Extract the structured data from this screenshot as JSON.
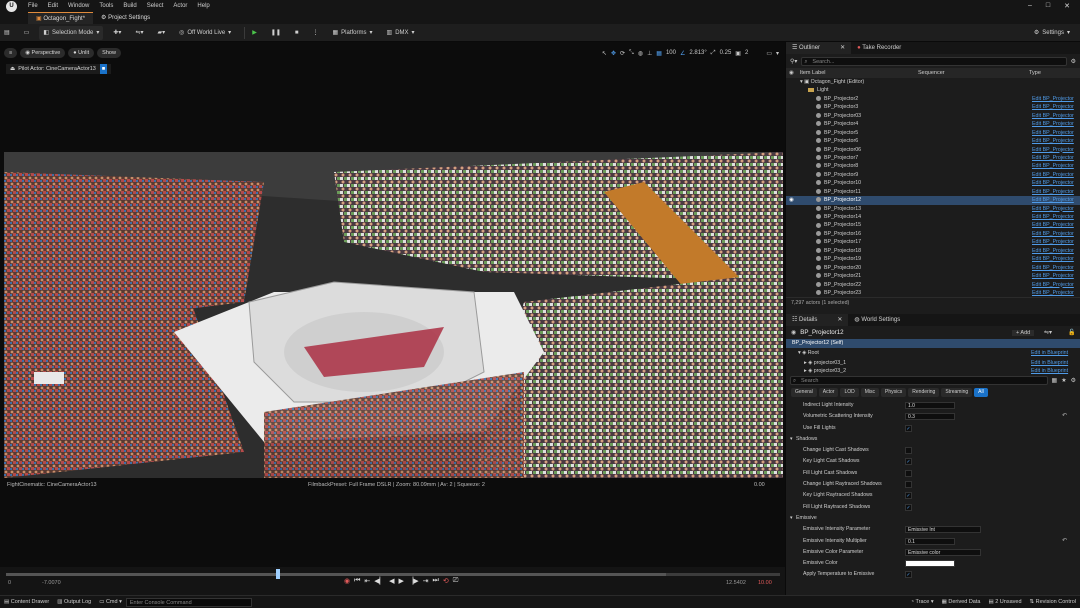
{
  "menu": {
    "logo": "U",
    "items": [
      "File",
      "Edit",
      "Window",
      "Tools",
      "Build",
      "Select",
      "Actor",
      "Help"
    ]
  },
  "window_controls": {
    "minimize": "–",
    "maximize": "□",
    "close": "✕"
  },
  "tabs": {
    "level": "Octagon_Fight*",
    "project_settings": "Project Settings"
  },
  "toolbar": {
    "selection_mode": "Selection Mode",
    "off_world": "Off World Live",
    "platforms": "Platforms",
    "dmx": "DMX",
    "settings": "Settings"
  },
  "viewport": {
    "perspective": "Perspective",
    "unlit": "Unlit",
    "show": "Show",
    "pilot": "Pilot Actor: CineCameraActor13",
    "snap": {
      "grid": "100",
      "angle": "2.813°",
      "scale": "0.25",
      "cams": "2"
    },
    "camera_label": "FightCinematic: CineCameraActor13",
    "filmback": "FilmbackPreset: Full Frame DSLR | Zoom: 80.09mm | Av: 2 | Squeeze: 2",
    "zero": "0.00",
    "scene_colors": {
      "floor": "#3a3a3a",
      "crowd": "#7d4b3a",
      "ring": "#e9e9e9",
      "stand": "#c27a2a"
    }
  },
  "timeline": {
    "start": "0",
    "left": "-7.0070",
    "end_left": "12.5402",
    "end": "10.00"
  },
  "statusbar": {
    "content_drawer": "Content Drawer",
    "output_log": "Output Log",
    "cmd": "Cmd",
    "console_placeholder": "Enter Console Command",
    "trace": "Trace",
    "derived_data": "Derived Data",
    "unsaved": "2 Unsaved",
    "revision": "Revision Control"
  },
  "outliner": {
    "tab": "Outliner",
    "tab2": "Take Recorder",
    "search_placeholder": "Search...",
    "col_label": "Item Label",
    "col_sequencer": "Sequencer",
    "col_type": "Type",
    "root": "Octagon_Fight (Editor)",
    "folder": "Light",
    "items": [
      "BP_Projector2",
      "BP_Projector3",
      "BP_Projector03",
      "BP_Projector4",
      "BP_Projector5",
      "BP_Projector6",
      "BP_Projector06",
      "BP_Projector7",
      "BP_Projector8",
      "BP_Projector9",
      "BP_Projector10",
      "BP_Projector11",
      "BP_Projector12",
      "BP_Projector13",
      "BP_Projector14",
      "BP_Projector15",
      "BP_Projector16",
      "BP_Projector17",
      "BP_Projector18",
      "BP_Projector19",
      "BP_Projector20",
      "BP_Projector21",
      "BP_Projector22",
      "BP_Projector23"
    ],
    "selected_index": 12,
    "type_link": "Edit BP_Projector",
    "count": "7,297 actors (1 selected)"
  },
  "details": {
    "tab": "Details",
    "tab2": "World Settings",
    "object": "BP_Projector12",
    "add": "+ Add",
    "comp_self": "BP_Projector12 (Self)",
    "comp_root": "Root",
    "comp_1": "projector03_1",
    "comp_2": "projector03_2",
    "edit_bp": "Edit in Blueprint",
    "search_placeholder": "Search",
    "filters": [
      "General",
      "Actor",
      "LOD",
      "Misc",
      "Physics",
      "Rendering",
      "Streaming",
      "All"
    ],
    "props": [
      {
        "label": "Indirect Light Intensity",
        "value": "1.0"
      },
      {
        "label": "Volumetric Scattering Intensity",
        "value": "0.3",
        "reset": true
      },
      {
        "label": "Use Fill Lights",
        "check": true
      },
      {
        "label": "Shadows",
        "section": true
      },
      {
        "label": "Change Light Cast Shadows",
        "check": false
      },
      {
        "label": "Key Light Cast Shadows",
        "check": true
      },
      {
        "label": "Fill Light Cast Shadows",
        "check": false
      },
      {
        "label": "Change Light Raytraced Shadows",
        "check": false
      },
      {
        "label": "Key Light Raytraced Shadows",
        "check": true
      },
      {
        "label": "Fill Light Raytraced Shadows",
        "check": true
      },
      {
        "label": "Emissive",
        "section": true
      },
      {
        "label": "Emissive Intensity Parameter",
        "value": "Emissive Int"
      },
      {
        "label": "Emissive Intensity Multiplier",
        "value": "0.1",
        "reset": true
      },
      {
        "label": "Emissive Color Parameter",
        "value": "Emissive color"
      },
      {
        "label": "Emissive Color",
        "color": true
      },
      {
        "label": "Apply Temperature to Emissive",
        "check": true
      }
    ]
  }
}
